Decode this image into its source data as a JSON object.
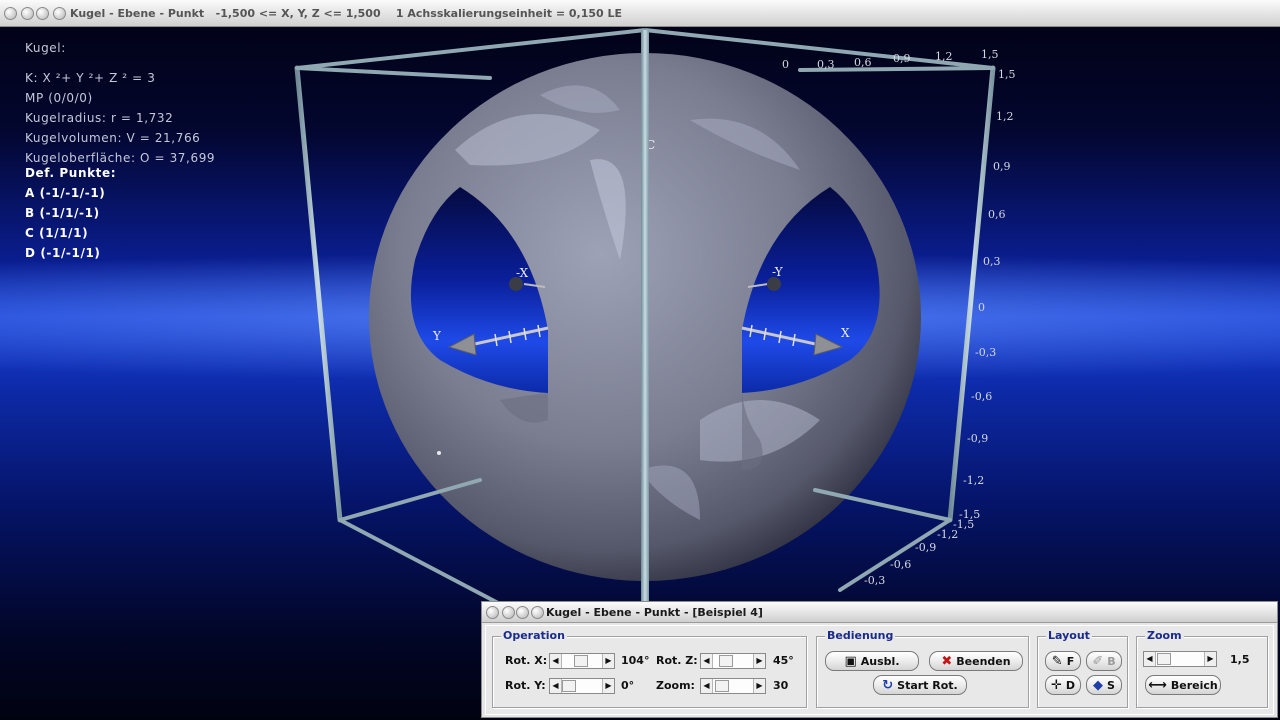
{
  "main_window": {
    "title": "Kugel - Ebene - Punkt   -1,500 <= X, Y, Z <= 1,500    1 Achsskalierungseinheit = 0,150 LE"
  },
  "info": {
    "heading": "Kugel:",
    "equation": "K: X ²+ Y ²+ Z ² = 3",
    "center": "MP (0/0/0)",
    "radius": "Kugelradius: r = 1,732",
    "volume": "Kugelvolumen: V = 21,766",
    "surface": "Kugeloberfläche: O = 37,699",
    "points_heading": "Def. Punkte:",
    "points": [
      "A (-1/-1/-1)",
      "B (-1/1/-1)",
      "C (1/1/1)",
      "D (-1/-1/1)"
    ]
  },
  "scene": {
    "point_label_c": "C",
    "axis_labels": {
      "x": "X",
      "y": "Y",
      "neg_x": "-X",
      "neg_y": "-Y"
    },
    "right_axis_ticks": [
      "1,5",
      "1,2",
      "0,9",
      "0,6",
      "0,3",
      "0",
      "-0,3",
      "-0,6",
      "-0,9",
      "-1,2",
      "-1,5"
    ],
    "top_axis_ticks": [
      "0",
      "0,3",
      "0,6",
      "0,9",
      "1,2",
      "1,5"
    ],
    "bottom_axis_ticks": [
      "-1,5",
      "-1,2",
      "-0,9",
      "-0,6",
      "-0,3"
    ]
  },
  "panel": {
    "title": "Kugel - Ebene - Punkt - [Beispiel 4]",
    "operation": {
      "label": "Operation",
      "rot_x_label": "Rot. X:",
      "rot_x_value": "104°",
      "rot_y_label": "Rot. Y:",
      "rot_y_value": "0°",
      "rot_z_label": "Rot. Z:",
      "rot_z_value": "45°",
      "zoom_label": "Zoom:",
      "zoom_value": "30"
    },
    "bedienung": {
      "label": "Bedienung",
      "ausbl": "Ausbl.",
      "beenden": "Beenden",
      "start_rot": "Start Rot."
    },
    "layout": {
      "label": "Layout",
      "f": "F",
      "b": "B",
      "d": "D",
      "s": "S"
    },
    "zoom": {
      "label": "Zoom",
      "value": "1,5",
      "bereich": "Bereich"
    }
  }
}
